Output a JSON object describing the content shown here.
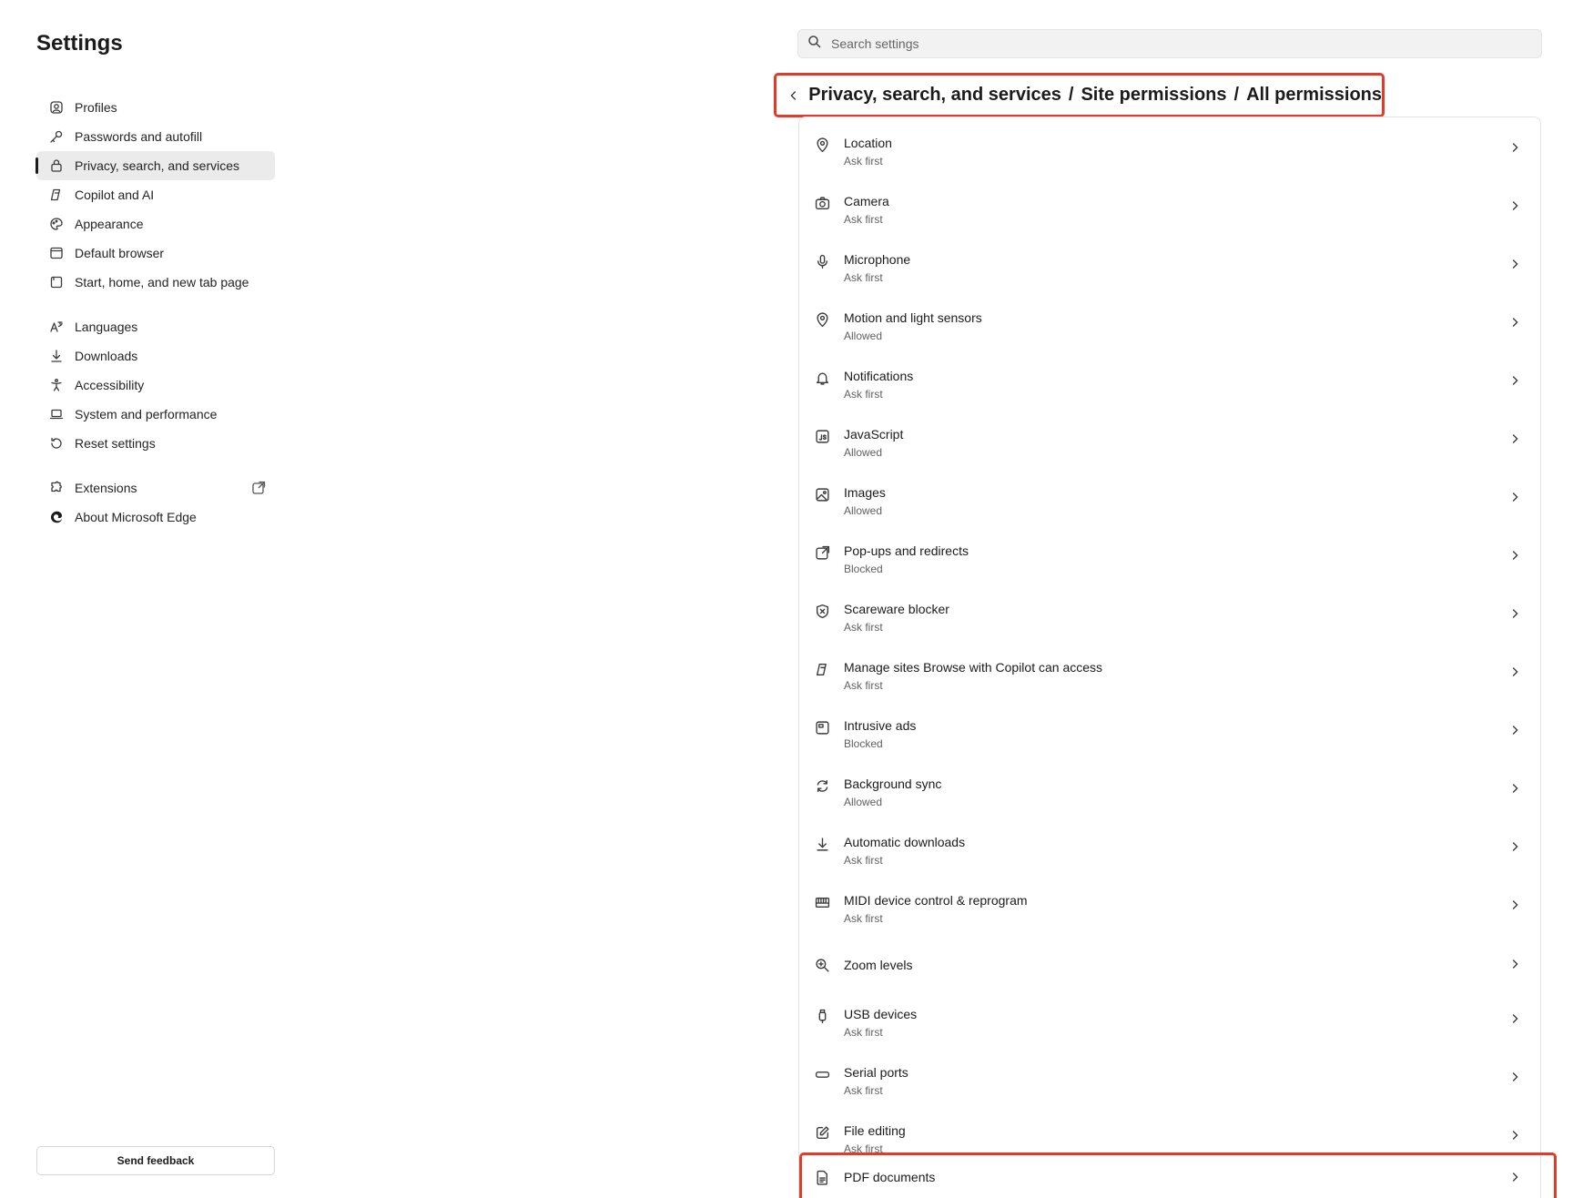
{
  "app_title": "Settings",
  "sidebar": {
    "group1": [
      {
        "label": "Profiles",
        "icon": "profile-icon"
      },
      {
        "label": "Passwords and autofill",
        "icon": "key-icon"
      },
      {
        "label": "Privacy, search, and services",
        "icon": "lock-icon",
        "active": true
      },
      {
        "label": "Copilot and AI",
        "icon": "copilot-icon"
      },
      {
        "label": "Appearance",
        "icon": "palette-icon"
      },
      {
        "label": "Default browser",
        "icon": "browser-icon"
      },
      {
        "label": "Start, home, and new tab page",
        "icon": "home-icon"
      }
    ],
    "group2": [
      {
        "label": "Languages",
        "icon": "language-icon"
      },
      {
        "label": "Downloads",
        "icon": "download-icon"
      },
      {
        "label": "Accessibility",
        "icon": "accessibility-icon"
      },
      {
        "label": "System and performance",
        "icon": "laptop-icon"
      },
      {
        "label": "Reset settings",
        "icon": "reset-icon"
      }
    ],
    "group3": [
      {
        "label": "Extensions",
        "icon": "puzzle-icon"
      },
      {
        "label": "About Microsoft Edge",
        "icon": "edge-logo-icon"
      }
    ],
    "feedback_label": "Send feedback"
  },
  "search": {
    "placeholder": "Search settings"
  },
  "breadcrumb": {
    "items": [
      "Privacy, search, and services",
      "Site permissions",
      "All permissions"
    ],
    "separator": "/"
  },
  "permissions": [
    {
      "title": "Location",
      "status": "Ask first",
      "icon": "location-icon"
    },
    {
      "title": "Camera",
      "status": "Ask first",
      "icon": "camera-icon"
    },
    {
      "title": "Microphone",
      "status": "Ask first",
      "icon": "microphone-icon"
    },
    {
      "title": "Motion and light sensors",
      "status": "Allowed",
      "icon": "sensor-icon"
    },
    {
      "title": "Notifications",
      "status": "Ask first",
      "icon": "bell-icon"
    },
    {
      "title": "JavaScript",
      "status": "Allowed",
      "icon": "javascript-icon"
    },
    {
      "title": "Images",
      "status": "Allowed",
      "icon": "image-icon"
    },
    {
      "title": "Pop-ups and redirects",
      "status": "Blocked",
      "icon": "popup-icon"
    },
    {
      "title": "Scareware blocker",
      "status": "Ask first",
      "icon": "shield-icon"
    },
    {
      "title": "Manage sites Browse with Copilot can access",
      "status": "Ask first",
      "icon": "copilot-icon"
    },
    {
      "title": "Intrusive ads",
      "status": "Blocked",
      "icon": "ads-icon"
    },
    {
      "title": "Background sync",
      "status": "Allowed",
      "icon": "sync-icon"
    },
    {
      "title": "Automatic downloads",
      "status": "Ask first",
      "icon": "download-icon"
    },
    {
      "title": "MIDI device control & reprogram",
      "status": "Ask first",
      "icon": "midi-icon"
    },
    {
      "title": "Zoom levels",
      "status": "",
      "icon": "zoom-icon"
    },
    {
      "title": "USB devices",
      "status": "Ask first",
      "icon": "usb-icon"
    },
    {
      "title": "Serial ports",
      "status": "Ask first",
      "icon": "serial-port-icon"
    },
    {
      "title": "File editing",
      "status": "Ask first",
      "icon": "file-edit-icon"
    },
    {
      "title": "PDF documents",
      "status": "",
      "icon": "pdf-icon"
    }
  ],
  "highlight_color": "#e03c2a"
}
